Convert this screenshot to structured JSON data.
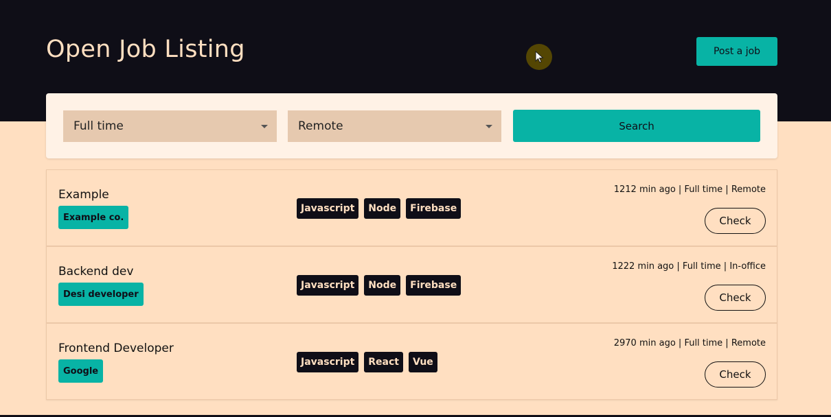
{
  "header": {
    "title": "Open Job Listing",
    "post_button_label": "Post a job"
  },
  "filters": {
    "job_type": "Full time",
    "location": "Remote",
    "search_label": "Search"
  },
  "jobs": [
    {
      "title": "Example",
      "company": "Example co.",
      "skills": [
        "Javascript",
        "Node",
        "Firebase"
      ],
      "posted": "1212 min ago",
      "type": "Full time",
      "location": "Remote",
      "action_label": "Check"
    },
    {
      "title": "Backend dev",
      "company": "Desi developer",
      "skills": [
        "Javascript",
        "Node",
        "Firebase"
      ],
      "posted": "1222 min ago",
      "type": "Full time",
      "location": "In-office",
      "action_label": "Check"
    },
    {
      "title": "Frontend Developer",
      "company": "Google",
      "skills": [
        "Javascript",
        "React",
        "Vue"
      ],
      "posted": "2970 min ago",
      "type": "Full time",
      "location": "Remote",
      "action_label": "Check"
    }
  ],
  "colors": {
    "dark": "#0f0e17",
    "peach": "#ffdfc1",
    "accent": "#08b3a5",
    "select_bg": "#e6c9af"
  },
  "icons": {
    "cursor": "mouse-pointer-icon",
    "caret": "chevron-down-icon"
  }
}
